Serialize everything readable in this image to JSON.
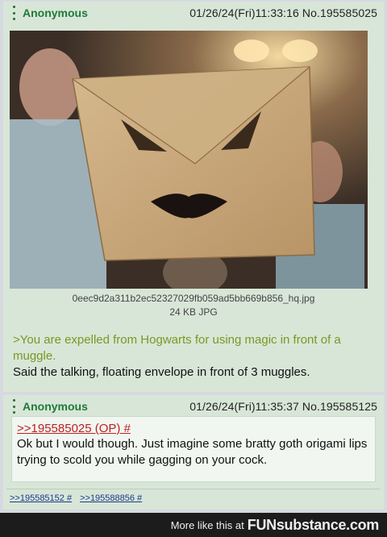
{
  "post1": {
    "name": "Anonymous",
    "datetime": "01/26/24(Fri)11:33:16 No.195585025",
    "file_name": "0eec9d2a311b2ec52327029fb059ad5bb669b856_hq.jpg",
    "file_size": "24 KB JPG",
    "greentext": ">You are expelled from Hogwarts for using magic in front of a muggle.",
    "comment": "Said the talking, floating envelope in front of 3 muggles."
  },
  "post2": {
    "name": "Anonymous",
    "datetime": "01/26/24(Fri)11:35:37 No.195585125",
    "quote": ">>195585025 (OP) #",
    "body": "Ok but I would though. Just imagine some bratty goth origami lips trying to scold you while gagging on your cock.",
    "backlinks": [
      ">>195585152 #",
      ">>195588856 #"
    ]
  },
  "footer": {
    "text": "More like this at",
    "brand_prefix": "FUN",
    "brand_suffix": "substance.com"
  },
  "colors": {
    "post_bg": "#d8e6d8",
    "name": "#1e7a3a",
    "greentext": "#789922",
    "quote": "#bb2222"
  },
  "icons": [
    "menu-dots-icon"
  ]
}
